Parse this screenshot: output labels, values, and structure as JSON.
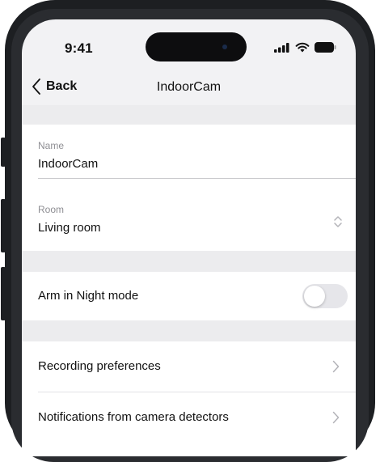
{
  "status_bar": {
    "time": "9:41",
    "icons": [
      "cellular-signal-icon",
      "wifi-icon",
      "battery-icon"
    ]
  },
  "nav": {
    "back_label": "Back",
    "title": "IndoorCam"
  },
  "name_field": {
    "label": "Name",
    "value": "IndoorCam"
  },
  "room_field": {
    "label": "Room",
    "value": "Living room"
  },
  "night_mode": {
    "label": "Arm in Night mode",
    "enabled": false
  },
  "menu_items": [
    {
      "label": "Recording preferences"
    },
    {
      "label": "Notifications from camera detectors"
    }
  ],
  "colors": {
    "screen_bg": "#f2f2f4",
    "card_bg": "#ffffff",
    "toggle_off": "#e6e6ea",
    "frame": "#1d1f22"
  }
}
